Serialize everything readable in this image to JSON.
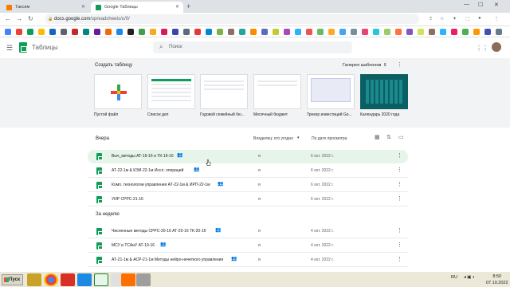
{
  "browser": {
    "tabs": [
      {
        "title": "Таксим",
        "active": false
      },
      {
        "title": "Google Таблицы",
        "active": true
      }
    ],
    "url_host": "docs.google.com",
    "url_path": "/spreadsheets/u/0/"
  },
  "app": {
    "title": "Таблицы",
    "search_placeholder": "Поиск"
  },
  "templates": {
    "heading": "Создать таблицу",
    "gallery_label": "Галерея шаблонов",
    "items": [
      {
        "label": "Пустой файл"
      },
      {
        "label": "Список дел"
      },
      {
        "label": "Годовой семейный бю..."
      },
      {
        "label": "Месячный бюджет"
      },
      {
        "label": "Трекер инвестиций Go..."
      },
      {
        "label": "Календарь 2020 года"
      }
    ]
  },
  "files": {
    "owner_filter": "Владелец: кто угодно",
    "sort_label": "По дате просмотра",
    "sections": [
      {
        "label": "Вчера",
        "rows": [
          {
            "name": "Выч_методы АТ-19-16 и ТК-19-16",
            "owner": "я",
            "date": "6 окт. 2022 г."
          },
          {
            "name": "АТ-22-1м & КЭИ-22-1м Иссл. операций",
            "owner": "я",
            "date": "6 окт. 2022 г."
          },
          {
            "name": "Комп. технологии управления АТ-22-1м & ИРП-22-1м",
            "owner": "я",
            "date": "6 окт. 2022 г."
          },
          {
            "name": "УИР СРРС-21-16",
            "owner": "я",
            "date": "6 окт. 2022 г."
          }
        ]
      },
      {
        "label": "За неделю",
        "rows": [
          {
            "name": "Численные методы СРРС-20-16 АТ-20-16 ТК-20-16",
            "owner": "я",
            "date": "4 окт. 2022 г."
          },
          {
            "name": "МСУ и ТСАиУ АТ-19-16",
            "owner": "я",
            "date": "4 окт. 2022 г."
          },
          {
            "name": "АТ-21-1м & АСР-21-1м Методы нейро-нечеткого управления",
            "owner": "я",
            "date": "4 окт. 2022 г."
          }
        ]
      }
    ]
  },
  "taskbar": {
    "start_label": "Пуск",
    "lang": "RU",
    "time": "8:50",
    "date": "07.10.2022"
  },
  "colors": {
    "sheets_green": "#0f9d58",
    "highlight_row": "#e6f4ea"
  }
}
